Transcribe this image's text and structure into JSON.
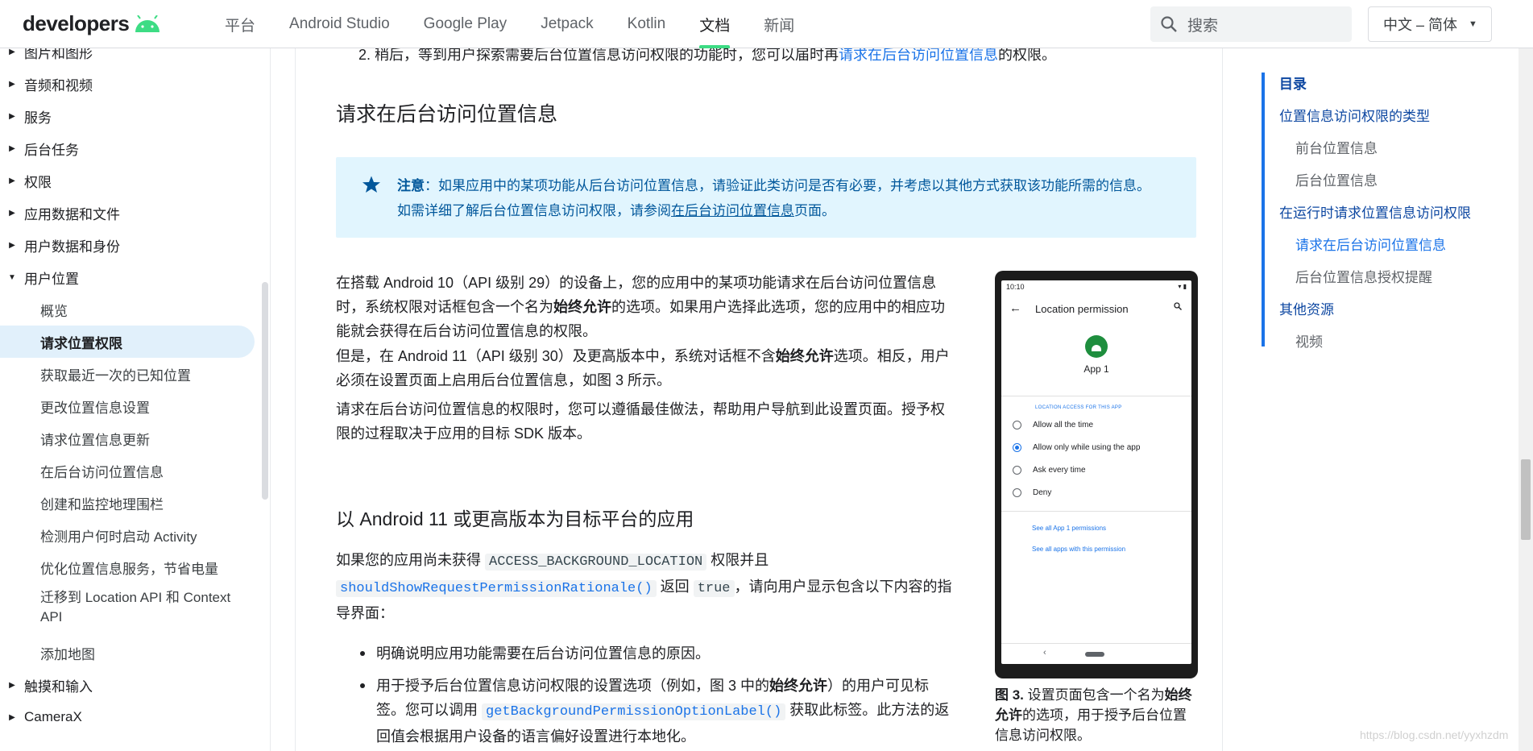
{
  "header": {
    "logo_text": "developers",
    "nav": [
      "平台",
      "Android Studio",
      "Google Play",
      "Jetpack",
      "Kotlin",
      "文档",
      "新闻"
    ],
    "active_nav": "文档",
    "search_placeholder": "搜索",
    "language": "中文 – 简体",
    "accent_color": "#3ddc84"
  },
  "sidebar": {
    "items": [
      {
        "label": "图片和图形",
        "type": "collapsed"
      },
      {
        "label": "音频和视频",
        "type": "collapsed"
      },
      {
        "label": "服务",
        "type": "collapsed"
      },
      {
        "label": "后台任务",
        "type": "collapsed"
      },
      {
        "label": "权限",
        "type": "collapsed"
      },
      {
        "label": "应用数据和文件",
        "type": "collapsed"
      },
      {
        "label": "用户数据和身份",
        "type": "collapsed"
      },
      {
        "label": "用户位置",
        "type": "expanded"
      },
      {
        "label": "概览",
        "type": "child"
      },
      {
        "label": "请求位置权限",
        "type": "child-active"
      },
      {
        "label": "获取最近一次的已知位置",
        "type": "child"
      },
      {
        "label": "更改位置信息设置",
        "type": "child"
      },
      {
        "label": "请求位置信息更新",
        "type": "child"
      },
      {
        "label": "在后台访问位置信息",
        "type": "child"
      },
      {
        "label": "创建和监控地理围栏",
        "type": "child"
      },
      {
        "label": "检测用户何时启动 Activity",
        "type": "child"
      },
      {
        "label": "优化位置信息服务，节省电量",
        "type": "child"
      },
      {
        "label": "迁移到 Location API 和 Context API",
        "type": "child"
      },
      {
        "label": "添加地图",
        "type": "child"
      },
      {
        "label": "触摸和输入",
        "type": "collapsed"
      },
      {
        "label": "CameraX",
        "type": "collapsed"
      }
    ]
  },
  "main": {
    "step_line_prefix": "2. 稍后，等到用户探索需要后台位置信息访问权限的功能时，您可以届时再",
    "step_line_link": "请求在后台访问位置信息",
    "step_line_suffix": "的权限。",
    "section_title": "请求在后台访问位置信息",
    "note": {
      "label": "注意",
      "line1": "：如果应用中的某项功能从后台访问位置信息，请验证此类访问是否有必要，并考虑以其他方式获取该功能所需的信息。",
      "line2_prefix": "如需详细了解后台位置信息访问权限，请参阅",
      "line2_link": "在后台访问位置信息",
      "line2_suffix": "页面。"
    },
    "p1_a": "在搭载 Android 10（API 级别 29）的设备上，您的应用中的某项功能请求在后台访问位置信息时，系统权限对话框包含一个名为",
    "p1_bold": "始终允许",
    "p1_b": "的选项。如果用户选择此选项，您的应用中的相应功能就会获得在后台访问位置信息的权限。",
    "p2_a": "但是，在 Android 11（API 级别 30）及更高版本中，系统对话框不含",
    "p2_bold": "始终允许",
    "p2_b": "选项。相反，用户必须在设置页面上启用后台位置信息，如图 3 所示。",
    "p3": "请求在后台访问位置信息的权限时，您可以遵循最佳做法，帮助用户导航到此设置页面。授予权限的过程取决于应用的目标 SDK 版本。",
    "sub_title": "以 Android 11 或更高版本为目标平台的应用",
    "p4_a": "如果您的应用尚未获得 ",
    "p4_code1": "ACCESS_BACKGROUND_LOCATION",
    "p4_b": " 权限并且 ",
    "p4_code2": "shouldShowRequestPermissionRationale()",
    "p4_c": " 返回 ",
    "p4_code3": "true",
    "p4_d": "，请向用户显示包含以下内容的指导界面：",
    "bullet1": "明确说明应用功能需要在后台访问位置信息的原因。",
    "bullet2_a": "用于授予后台位置信息访问权限的设置选项（例如，图 3 中的",
    "bullet2_bold": "始终允许",
    "bullet2_b": "）的用户可见标签。您可以调用 ",
    "bullet2_code": "getBackgroundPermissionOptionLabel()",
    "bullet2_c": " 获取此标签。此方法的返回值会根据用户设备的语言偏好设置进行本地化。"
  },
  "phone": {
    "time": "10:10",
    "title": "Location permission",
    "app_name": "App 1",
    "category": "LOCATION ACCESS FOR THIS APP",
    "options": [
      "Allow all the time",
      "Allow only while using the app",
      "Ask every time",
      "Deny"
    ],
    "selected_option": "Allow only while using the app",
    "link1": "See all App 1 permissions",
    "link2": "See all apps with this permission"
  },
  "caption": {
    "label": "图 3.",
    "text_a": " 设置页面包含一个名为",
    "bold": "始终允许",
    "text_b": "的选项，用于授予后台位置信息访问权限。"
  },
  "toc": {
    "title": "目录",
    "items": [
      {
        "label": "位置信息访问权限的类型",
        "level": 1
      },
      {
        "label": "前台位置信息",
        "level": 2
      },
      {
        "label": "后台位置信息",
        "level": 2
      },
      {
        "label": "在运行时请求位置信息访问权限",
        "level": 1
      },
      {
        "label": "请求在后台访问位置信息",
        "level": 2,
        "current": true
      },
      {
        "label": "后台位置信息授权提醒",
        "level": 2
      },
      {
        "label": "其他资源",
        "level": 1
      },
      {
        "label": "视频",
        "level": 2
      }
    ]
  },
  "watermark": "https://blog.csdn.net/yyxhzdm"
}
